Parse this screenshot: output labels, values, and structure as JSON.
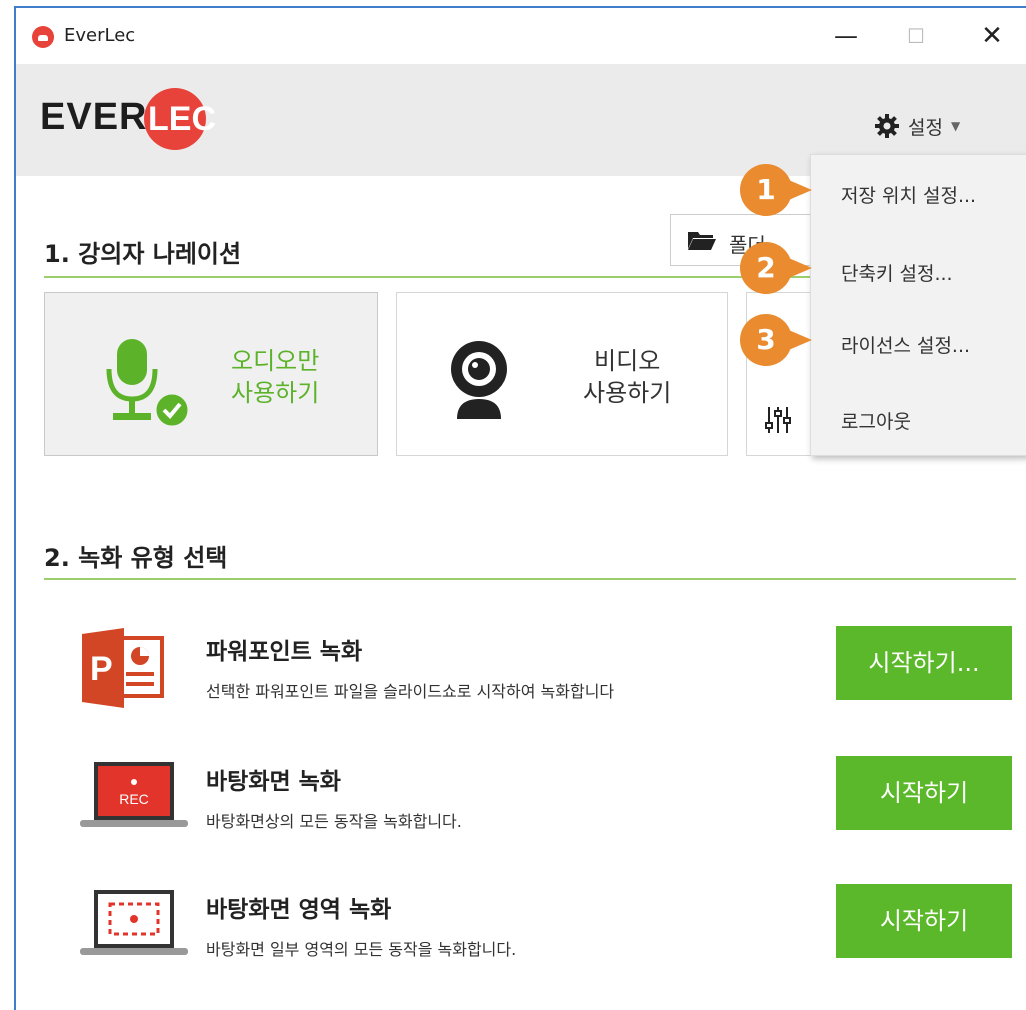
{
  "window": {
    "title": "EverLec"
  },
  "logo": {
    "part1": "EVER",
    "part2": "LEC"
  },
  "settings": {
    "label": "설정",
    "icon": "gear-icon"
  },
  "settings_menu": [
    {
      "label": "저장 위치 설정...",
      "callout": "1"
    },
    {
      "label": "단축키 설정...",
      "callout": "2"
    },
    {
      "label": "라이선스 설정...",
      "callout": "3"
    },
    {
      "label": "로그아웃"
    }
  ],
  "section1": {
    "title": "1. 강의자 나레이션",
    "folder_label": "폴더",
    "cards": [
      {
        "line1": "오디오만",
        "line2": "사용하기",
        "icon": "microphone-icon",
        "selected": true
      },
      {
        "line1": "비디오",
        "line2": "사용하기",
        "icon": "webcam-icon",
        "selected": false
      }
    ]
  },
  "section2": {
    "title": "2. 녹화 유형 선택",
    "rows": [
      {
        "title": "파워포인트 녹화",
        "desc": "선택한 파워포인트 파일을 슬라이드쇼로 시작하여 녹화합니다",
        "button": "시작하기...",
        "icon": "powerpoint-icon"
      },
      {
        "title": "바탕화면 녹화",
        "desc": "바탕화면상의 모든 동작을 녹화합니다.",
        "button": "시작하기",
        "icon": "screen-record-icon",
        "badge": "REC"
      },
      {
        "title": "바탕화면 영역 녹화",
        "desc": "바탕화면 일부 영역의 모든 동작을 녹화합니다.",
        "button": "시작하기",
        "icon": "area-record-icon"
      }
    ]
  },
  "colors": {
    "accent_green": "#5cb82b",
    "brand_red": "#e8433b",
    "callout_orange": "#ea8b2f"
  }
}
